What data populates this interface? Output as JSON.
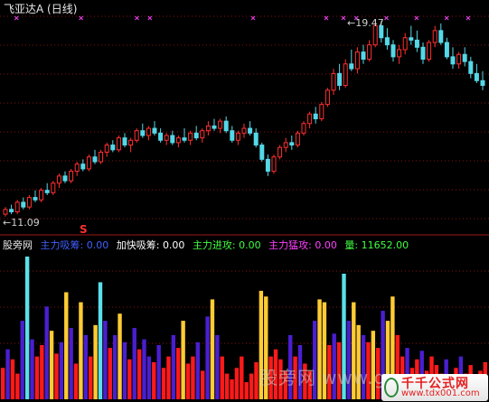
{
  "header": {
    "title": "飞亚达A (日线)",
    "high_label": "19.47",
    "low_label": "11.09",
    "signal_text": "S"
  },
  "indicator": {
    "name": "股旁网",
    "items": [
      {
        "label": "主力吸筹:",
        "value": "0.00",
        "color": "#4060ff"
      },
      {
        "label": "加快吸筹:",
        "value": "0.00",
        "color": "#ffffff"
      },
      {
        "label": "主力进攻:",
        "value": "0.00",
        "color": "#40ff40"
      },
      {
        "label": "主力猛攻:",
        "value": "0.00",
        "color": "#ff40ff"
      },
      {
        "label": "量:",
        "value": "11652.00",
        "color": "#40ff40"
      }
    ]
  },
  "watermark": {
    "site_cn": "股旁网",
    "site_partial": "www.gu",
    "brand_cn": "千千公式网",
    "brand_url": "www.tdx001.com"
  },
  "colors": {
    "up": "#ff3030",
    "down": "#54d8e8",
    "bar_red": "#ff1a1a",
    "bar_blue": "#4a1fd0",
    "bar_yellow": "#ffcc33",
    "bar_cyan": "#5ae0e8",
    "marker": "#e040e0",
    "grid": "#8a1010"
  },
  "chart_data": {
    "type": "candlestick_with_volume",
    "price_range": [
      11.09,
      19.47
    ],
    "ohlc": [
      [
        11.3,
        11.6,
        11.2,
        11.5
      ],
      [
        11.5,
        11.7,
        11.3,
        11.4
      ],
      [
        11.4,
        11.9,
        11.3,
        11.8
      ],
      [
        11.8,
        12.0,
        11.5,
        11.6
      ],
      [
        11.6,
        12.1,
        11.5,
        12.0
      ],
      [
        12.0,
        12.3,
        11.8,
        11.9
      ],
      [
        11.9,
        12.4,
        11.8,
        12.3
      ],
      [
        12.3,
        12.6,
        12.1,
        12.2
      ],
      [
        12.2,
        12.7,
        12.1,
        12.6
      ],
      [
        12.6,
        13.0,
        12.4,
        12.9
      ],
      [
        12.9,
        13.1,
        12.6,
        12.7
      ],
      [
        12.7,
        13.2,
        12.6,
        13.1
      ],
      [
        13.1,
        13.5,
        12.9,
        13.4
      ],
      [
        13.4,
        13.6,
        13.1,
        13.2
      ],
      [
        13.2,
        13.8,
        13.1,
        13.7
      ],
      [
        13.7,
        14.0,
        13.4,
        13.5
      ],
      [
        13.5,
        14.0,
        13.4,
        13.9
      ],
      [
        13.9,
        14.3,
        13.7,
        14.2
      ],
      [
        14.2,
        14.4,
        13.9,
        14.0
      ],
      [
        14.0,
        14.6,
        13.9,
        14.5
      ],
      [
        14.5,
        14.7,
        14.1,
        14.2
      ],
      [
        14.2,
        14.5,
        13.9,
        14.4
      ],
      [
        14.4,
        14.9,
        14.3,
        14.8
      ],
      [
        14.8,
        15.1,
        14.5,
        14.6
      ],
      [
        14.6,
        15.0,
        14.4,
        14.9
      ],
      [
        14.9,
        15.2,
        14.6,
        14.7
      ],
      [
        14.7,
        14.9,
        14.3,
        14.4
      ],
      [
        14.4,
        14.7,
        14.2,
        14.6
      ],
      [
        14.6,
        14.8,
        14.2,
        14.3
      ],
      [
        14.3,
        14.6,
        14.1,
        14.5
      ],
      [
        14.5,
        14.9,
        14.3,
        14.4
      ],
      [
        14.4,
        14.8,
        14.2,
        14.7
      ],
      [
        14.7,
        15.0,
        14.4,
        14.5
      ],
      [
        14.5,
        14.9,
        14.3,
        14.8
      ],
      [
        14.8,
        15.2,
        14.6,
        15.0
      ],
      [
        15.0,
        15.3,
        14.8,
        14.9
      ],
      [
        14.9,
        15.3,
        14.7,
        15.2
      ],
      [
        15.2,
        15.4,
        14.7,
        14.8
      ],
      [
        14.8,
        15.0,
        14.3,
        14.4
      ],
      [
        14.4,
        14.8,
        14.2,
        14.7
      ],
      [
        14.7,
        15.1,
        14.5,
        14.9
      ],
      [
        14.9,
        15.2,
        14.6,
        14.7
      ],
      [
        14.7,
        14.9,
        14.1,
        14.2
      ],
      [
        14.2,
        14.3,
        13.5,
        13.6
      ],
      [
        13.6,
        13.8,
        12.9,
        13.1
      ],
      [
        13.1,
        13.8,
        13.0,
        13.7
      ],
      [
        13.7,
        14.2,
        13.6,
        14.1
      ],
      [
        14.1,
        14.5,
        13.9,
        14.3
      ],
      [
        14.3,
        14.6,
        14.0,
        14.2
      ],
      [
        14.2,
        14.8,
        14.1,
        14.7
      ],
      [
        14.7,
        15.2,
        14.6,
        15.1
      ],
      [
        15.1,
        15.6,
        14.9,
        15.5
      ],
      [
        15.5,
        15.8,
        15.1,
        15.3
      ],
      [
        15.3,
        16.0,
        15.2,
        15.9
      ],
      [
        15.9,
        16.6,
        15.8,
        16.5
      ],
      [
        16.5,
        17.4,
        16.3,
        17.2
      ],
      [
        17.2,
        17.6,
        16.5,
        16.7
      ],
      [
        16.7,
        17.8,
        16.6,
        17.6
      ],
      [
        17.6,
        18.2,
        17.3,
        17.4
      ],
      [
        17.4,
        18.3,
        17.2,
        18.1
      ],
      [
        18.1,
        18.4,
        17.6,
        17.8
      ],
      [
        17.8,
        18.6,
        17.7,
        18.4
      ],
      [
        18.4,
        19.47,
        18.3,
        19.2
      ],
      [
        19.2,
        19.4,
        18.5,
        18.7
      ],
      [
        18.7,
        19.1,
        18.2,
        18.4
      ],
      [
        18.4,
        18.6,
        17.7,
        17.9
      ],
      [
        17.9,
        18.4,
        17.6,
        18.2
      ],
      [
        18.2,
        18.9,
        18.0,
        18.7
      ],
      [
        18.7,
        19.2,
        18.4,
        18.6
      ],
      [
        18.6,
        19.0,
        18.1,
        18.3
      ],
      [
        18.3,
        18.5,
        17.6,
        17.8
      ],
      [
        17.8,
        18.6,
        17.7,
        18.5
      ],
      [
        18.5,
        19.2,
        18.3,
        19.0
      ],
      [
        19.0,
        19.3,
        18.4,
        18.5
      ],
      [
        18.5,
        18.7,
        17.8,
        17.9
      ],
      [
        17.9,
        18.3,
        17.4,
        17.6
      ],
      [
        17.6,
        18.1,
        17.4,
        18.0
      ],
      [
        18.0,
        18.3,
        17.5,
        17.7
      ],
      [
        17.7,
        17.9,
        17.0,
        17.2
      ],
      [
        17.2,
        17.6,
        16.8,
        16.9
      ],
      [
        16.9,
        17.3,
        16.5,
        16.7
      ]
    ],
    "volume_bars": [
      [
        0.22,
        "red"
      ],
      [
        0.35,
        "blue"
      ],
      [
        0.28,
        "red"
      ],
      [
        0.18,
        "red"
      ],
      [
        0.55,
        "blue"
      ],
      [
        1.0,
        "cyan"
      ],
      [
        0.42,
        "blue"
      ],
      [
        0.3,
        "red"
      ],
      [
        0.38,
        "red"
      ],
      [
        0.65,
        "blue"
      ],
      [
        0.48,
        "yellow"
      ],
      [
        0.32,
        "red"
      ],
      [
        0.4,
        "blue"
      ],
      [
        0.75,
        "yellow"
      ],
      [
        0.5,
        "blue"
      ],
      [
        0.25,
        "red"
      ],
      [
        0.68,
        "yellow"
      ],
      [
        0.45,
        "blue"
      ],
      [
        0.3,
        "red"
      ],
      [
        0.52,
        "yellow"
      ],
      [
        0.82,
        "cyan"
      ],
      [
        0.55,
        "blue"
      ],
      [
        0.36,
        "red"
      ],
      [
        0.45,
        "blue"
      ],
      [
        0.6,
        "yellow"
      ],
      [
        0.4,
        "blue"
      ],
      [
        0.28,
        "red"
      ],
      [
        0.5,
        "blue"
      ],
      [
        0.35,
        "red"
      ],
      [
        0.42,
        "blue"
      ],
      [
        0.3,
        "blue"
      ],
      [
        0.26,
        "red"
      ],
      [
        0.38,
        "blue"
      ],
      [
        0.22,
        "red"
      ],
      [
        0.3,
        "red"
      ],
      [
        0.45,
        "blue"
      ],
      [
        0.36,
        "red"
      ],
      [
        0.55,
        "yellow"
      ],
      [
        0.25,
        "red"
      ],
      [
        0.3,
        "red"
      ],
      [
        0.4,
        "blue"
      ],
      [
        0.2,
        "red"
      ],
      [
        0.58,
        "blue"
      ],
      [
        0.7,
        "yellow"
      ],
      [
        0.45,
        "blue"
      ],
      [
        0.3,
        "red"
      ],
      [
        0.18,
        "red"
      ],
      [
        0.14,
        "red"
      ],
      [
        0.22,
        "red"
      ],
      [
        0.3,
        "red"
      ],
      [
        0.12,
        "red"
      ],
      [
        0.18,
        "red"
      ],
      [
        0.26,
        "red"
      ],
      [
        0.76,
        "yellow"
      ],
      [
        0.72,
        "yellow"
      ],
      [
        0.3,
        "red"
      ],
      [
        0.35,
        "red"
      ],
      [
        0.28,
        "red"
      ],
      [
        0.2,
        "red"
      ],
      [
        0.45,
        "blue"
      ],
      [
        0.3,
        "red"
      ],
      [
        0.38,
        "blue"
      ],
      [
        0.25,
        "red"
      ],
      [
        0.2,
        "red"
      ],
      [
        0.55,
        "blue"
      ],
      [
        0.7,
        "yellow"
      ],
      [
        0.68,
        "yellow"
      ],
      [
        0.38,
        "red"
      ],
      [
        0.46,
        "blue"
      ],
      [
        0.4,
        "red"
      ],
      [
        0.88,
        "cyan"
      ],
      [
        0.55,
        "blue"
      ],
      [
        0.68,
        "yellow"
      ],
      [
        0.52,
        "yellow"
      ],
      [
        0.45,
        "blue"
      ],
      [
        0.4,
        "red"
      ],
      [
        0.48,
        "yellow"
      ],
      [
        0.36,
        "red"
      ],
      [
        0.62,
        "blue"
      ],
      [
        0.55,
        "yellow"
      ],
      [
        0.72,
        "yellow"
      ],
      [
        0.45,
        "red"
      ],
      [
        0.3,
        "red"
      ],
      [
        0.36,
        "blue"
      ],
      [
        0.22,
        "red"
      ],
      [
        0.28,
        "red"
      ],
      [
        0.34,
        "blue"
      ],
      [
        0.2,
        "red"
      ],
      [
        0.3,
        "red"
      ],
      [
        0.24,
        "red"
      ],
      [
        0.18,
        "red"
      ],
      [
        0.28,
        "blue"
      ],
      [
        0.16,
        "red"
      ],
      [
        0.22,
        "red"
      ],
      [
        0.3,
        "blue"
      ],
      [
        0.18,
        "red"
      ],
      [
        0.24,
        "red"
      ],
      [
        0.14,
        "red"
      ],
      [
        0.2,
        "red"
      ],
      [
        0.26,
        "red"
      ]
    ],
    "markers_top": [
      3,
      18,
      31,
      34,
      58,
      75,
      79,
      82,
      89,
      96,
      103,
      108
    ]
  }
}
